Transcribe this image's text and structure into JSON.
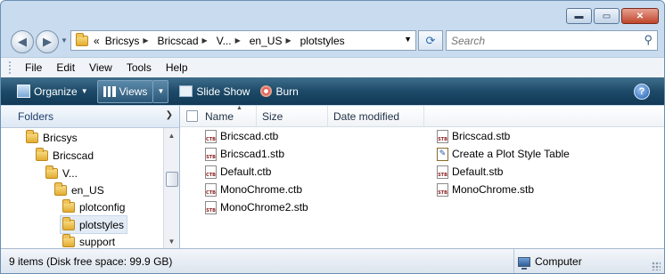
{
  "window_controls": {
    "minimize": "▬",
    "maximize": "▭",
    "close": "✕"
  },
  "nav": {
    "back_glyph": "◀",
    "forward_glyph": "▶"
  },
  "address": {
    "overflow": "«",
    "crumbs": [
      "Bricsys",
      "Bricscad",
      "V...",
      "en_US",
      "plotstyles"
    ]
  },
  "search": {
    "placeholder": "Search"
  },
  "menu": {
    "items": [
      "File",
      "Edit",
      "View",
      "Tools",
      "Help"
    ]
  },
  "toolbar": {
    "organize": "Organize",
    "views": "Views",
    "slideshow": "Slide Show",
    "burn": "Burn",
    "help": "?"
  },
  "navpane": {
    "title": "Folders",
    "tree": [
      {
        "label": "Bricsys",
        "level": 0,
        "selected": false
      },
      {
        "label": "Bricscad",
        "level": 1,
        "selected": false
      },
      {
        "label": "V...",
        "level": 2,
        "selected": false
      },
      {
        "label": "en_US",
        "level": 3,
        "selected": false
      },
      {
        "label": "plotconfig",
        "level": 4,
        "selected": false
      },
      {
        "label": "plotstyles",
        "level": 4,
        "selected": true
      },
      {
        "label": "support",
        "level": 4,
        "selected": false
      }
    ]
  },
  "columns": {
    "name": "Name",
    "size": "Size",
    "date": "Date modified"
  },
  "files": [
    {
      "name": "Bricscad.ctb",
      "icon": "ctb-file-icon",
      "tag": "CTB"
    },
    {
      "name": "Bricscad1.stb",
      "icon": "stb-file-icon",
      "tag": "STB"
    },
    {
      "name": "Default.ctb",
      "icon": "ctb-file-icon",
      "tag": "CTB"
    },
    {
      "name": "MonoChrome.ctb",
      "icon": "ctb-file-icon",
      "tag": "CTB"
    },
    {
      "name": "MonoChrome2.stb",
      "icon": "stb-file-icon",
      "tag": "STB"
    },
    {
      "name": "Bricscad.stb",
      "icon": "stb-file-icon",
      "tag": "STB"
    },
    {
      "name": "Create a Plot Style Table",
      "icon": "wizard-shortcut-icon",
      "tag": ""
    },
    {
      "name": "Default.stb",
      "icon": "stb-file-icon",
      "tag": "STB"
    },
    {
      "name": "MonoChrome.stb",
      "icon": "stb-file-icon",
      "tag": "STB"
    }
  ],
  "status": {
    "count": "9 items (Disk free space: 99.9 GB)",
    "location": "Computer"
  }
}
